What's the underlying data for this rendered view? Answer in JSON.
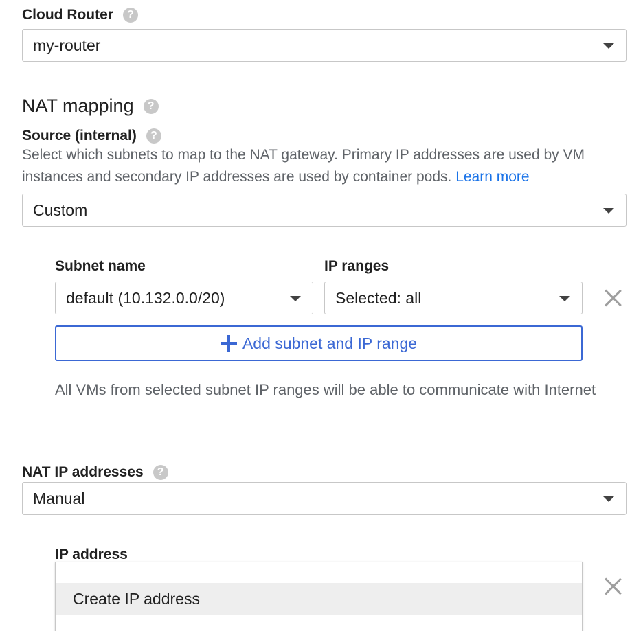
{
  "cloud_router": {
    "label": "Cloud Router",
    "value": "my-router"
  },
  "nat_mapping": {
    "title": "NAT mapping",
    "source_label": "Source (internal)",
    "description": "Select which subnets to map to the NAT gateway. Primary IP addresses are used by VM instances and secondary IP addresses are used by container pods.",
    "learn_more": "Learn more",
    "source_value": "Custom",
    "subnet_name_label": "Subnet name",
    "ip_ranges_label": "IP ranges",
    "subnet_value": "default (10.132.0.0/20)",
    "ip_ranges_value": "Selected: all",
    "add_button_label": "Add subnet and IP range",
    "info_text": "All VMs from selected subnet IP ranges will be able to communicate with Internet"
  },
  "nat_ip": {
    "label": "NAT IP addresses",
    "value": "Manual",
    "ip_address_label": "IP address",
    "dropdown_option": "Create IP address"
  },
  "icons": {
    "help": "help-icon",
    "close": "close-icon",
    "plus": "plus-icon",
    "caret": "chevron-down-icon"
  },
  "colors": {
    "accent": "#3b68d4",
    "link": "#1a73e8",
    "help_icon": "#c8c8c8"
  }
}
